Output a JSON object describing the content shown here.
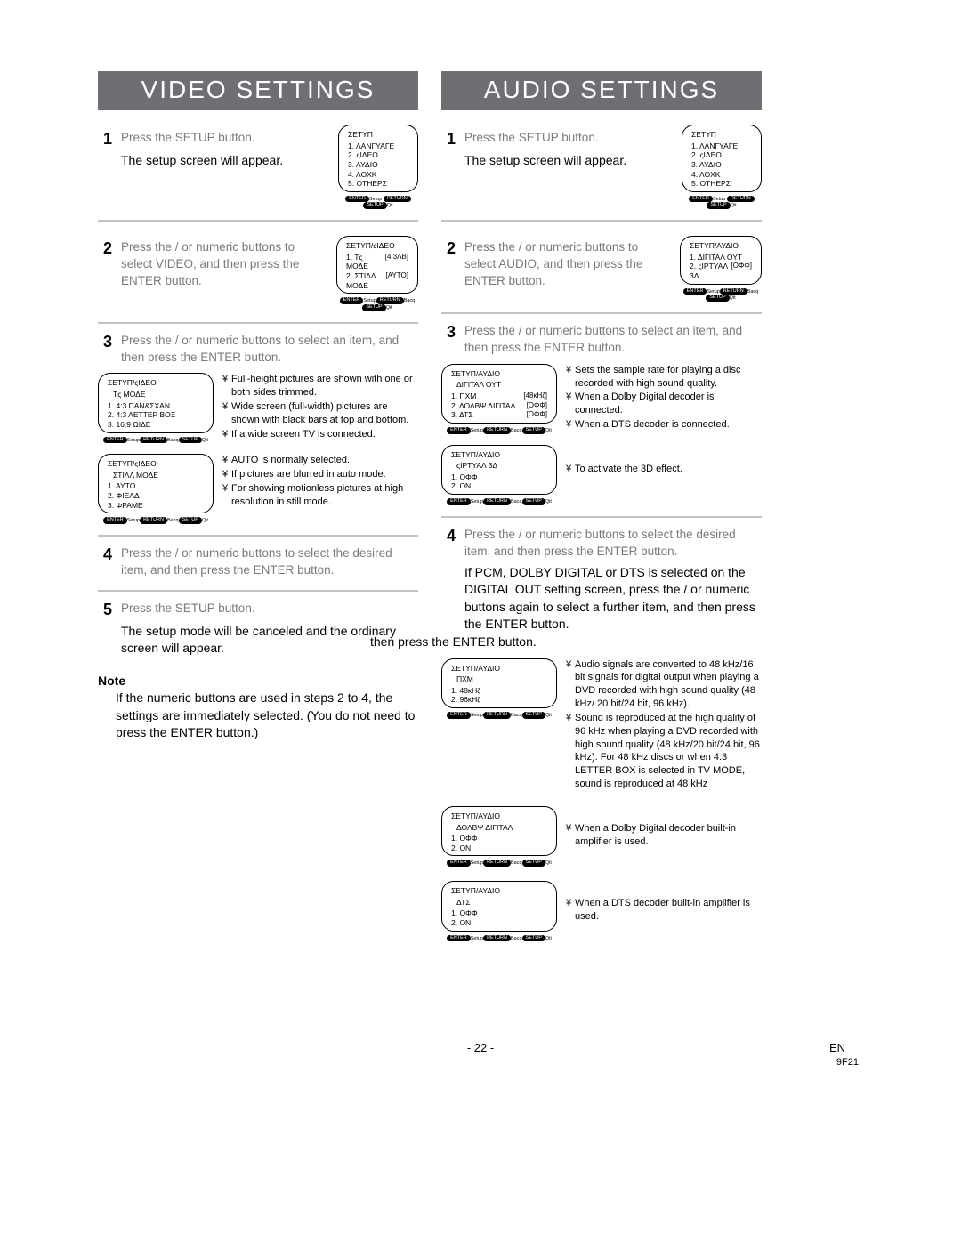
{
  "headers": {
    "video": "VIDEO SETTINGS",
    "audio": "AUDIO SETTINGS"
  },
  "video": {
    "step1": {
      "num": "1",
      "instr": "Press the SETUP button.",
      "result": "The setup screen will appear.",
      "osd": {
        "title": "ΣΕΤΥΠ",
        "items": [
          "1. ΛΑΝΓΥΑΓΕ",
          "2. ςΙΔΕΟ",
          "3. ΑΥΔΙΟ",
          "4. ΛΟΧΚ",
          "5. ΟΤΗΕΡΣ"
        ]
      }
    },
    "step2": {
      "num": "2",
      "instr": "Press the    /   or numeric buttons to select VIDEO, and then press the ENTER button.",
      "osd": {
        "title": "ΣΕΤΥΠ/ςΙΔΕΟ",
        "items": [
          {
            "lab": "1. Τς ΜΟΔΕ",
            "val": "[4:3ΛΒ]"
          },
          {
            "lab": "2. ΣΤΙΛΛ ΜΟΔΕ",
            "val": "[ΑΥΤΟ]"
          }
        ]
      }
    },
    "step3": {
      "num": "3",
      "instr": "Press the    /   or numeric buttons to select an item, and then press the ENTER button.",
      "osd1": {
        "title": "ΣΕΤΥΠ/ςΙΔΕΟ",
        "sub": "Τς ΜΟΔΕ",
        "items": [
          "1. 4:3 ΠΑΝ&ΣΧΑΝ",
          "2. 4:3 ΛΕΤΤΕΡ ΒΟΞ",
          "3. 16:9 ΩΙΔΕ"
        ]
      },
      "callouts1": [
        "Full-height pictures are shown with one or both sides trimmed.",
        "Wide screen (full-width) pictures are shown with black bars at top and bottom.",
        "If a wide screen TV is connected."
      ],
      "osd2": {
        "title": "ΣΕΤΥΠ/ςΙΔΕΟ",
        "sub": "ΣΤΙΛΛ ΜΟΔΕ",
        "items": [
          "1. ΑΥΤΟ",
          "2. ΦΙΕΛΔ",
          "3. ΦΡΑΜΕ"
        ]
      },
      "callouts2": [
        "AUTO is normally selected.",
        "If pictures are blurred in auto mode.",
        "For showing motionless pictures at high resolution in still mode."
      ]
    },
    "step4": {
      "num": "4",
      "instr": "Press the    /   or numeric buttons to select the desired item, and then press the ENTER button."
    },
    "step5": {
      "num": "5",
      "instr": "Press the SETUP button.",
      "result": "The setup mode will be canceled and the ordinary screen will appear."
    },
    "note_head": "Note",
    "note": "If the numeric buttons are used in steps 2 to 4, the settings are immediately selected. (You do not need to press the ENTER button.)"
  },
  "audio": {
    "step1": {
      "num": "1",
      "instr": "Press the SETUP button.",
      "result": "The setup screen will appear.",
      "osd": {
        "title": "ΣΕΤΥΠ",
        "items": [
          "1. ΛΑΝΓΥΑΓΕ",
          "2. ςΙΔΕΟ",
          "3. ΑΥΔΙΟ",
          "4. ΛΟΧΚ",
          "5. ΟΤΗΕΡΣ"
        ]
      }
    },
    "step2": {
      "num": "2",
      "instr": "Press the    /   or numeric buttons to select AUDIO, and then press the ENTER button.",
      "osd": {
        "title": "ΣΕΤΥΠ/ΑΥΔΙΟ",
        "items": [
          {
            "lab": "1. ΔΙΓΙΤΑΛ ΟΥΤ",
            "val": ""
          },
          {
            "lab": "2. ςΙΡΤΥΑΛ 3Δ",
            "val": "[ΟΦΦ]"
          }
        ]
      }
    },
    "step3": {
      "num": "3",
      "instr": "Press the    /   or numeric buttons to select an item, and then press the ENTER button.",
      "osd1": {
        "title": "ΣΕΤΥΠ/ΑΥΔΙΟ",
        "sub": "ΔΙΓΙΤΑΛ ΟΥΤ",
        "items": [
          {
            "lab": "1. ΠΧΜ",
            "val": "[48κΗζ]"
          },
          {
            "lab": "2. ΔΟΛΒΨ ΔΙΓΙΤΑΛ",
            "val": "[ΟΦΦ]"
          },
          {
            "lab": "3. ΔΤΣ",
            "val": "[ΟΦΦ]"
          }
        ]
      },
      "callouts1": [
        "Sets the sample rate for playing a disc recorded with high sound quality.",
        "When a Dolby Digital decoder is connected.",
        "When a DTS decoder is connected."
      ],
      "osd2": {
        "title": "ΣΕΤΥΠ/ΑΥΔΙΟ",
        "sub": "ςΙΡΤΥΑΛ 3Δ",
        "items": [
          "1. ΟΦΦ",
          "2. ΟΝ"
        ]
      },
      "callouts2": [
        "To activate the 3D effect."
      ]
    },
    "step4": {
      "num": "4",
      "instr": "Press the    /   or numeric buttons to select the desired item, and then press the ENTER button."
    },
    "conditional": "If PCM, DOLBY DIGITAL or DTS is selected on the DIGITAL OUT setting screen, press the  /  or numeric buttons again to select a further item, and then press the ENTER button.",
    "pcm_osd": {
      "title": "ΣΕΤΥΠ/ΑΥΔΙΟ",
      "sub": "ΠΧΜ",
      "items": [
        "1. 48κΗζ",
        "2. 96κΗζ"
      ]
    },
    "pcm_callouts": [
      "Audio signals are converted to 48 kHz/16 bit signals for digital output when playing a DVD recorded with high sound quality (48 kHz/ 20 bit/24 bit, 96 kHz).",
      "Sound is reproduced at the high quality of 96 kHz when playing a DVD recorded with high sound quality (48 kHz/20 bit/24 bit, 96 kHz). For 48 kHz discs or when 4:3 LETTER BOX is selected in TV MODE, sound is reproduced at 48 kHz"
    ],
    "dolby_osd": {
      "title": "ΣΕΤΥΠ/ΑΥΔΙΟ",
      "sub": "ΔΟΛΒΨ ΔΙΓΙΤΑΛ",
      "items": [
        "1. ΟΦΦ",
        "2. ΟΝ"
      ]
    },
    "dolby_callouts": [
      "When a Dolby Digital decoder built-in amplifier is used."
    ],
    "dts_osd": {
      "title": "ΣΕΤΥΠ/ΑΥΔΙΟ",
      "sub": "ΔΤΣ",
      "items": [
        "1. ΟΦΦ",
        "2. ΟΝ"
      ]
    },
    "dts_callouts": [
      "When a DTS decoder built-in amplifier is used."
    ]
  },
  "osd_btns": {
    "enter": "ENTER",
    "setup_lbl": "Setup",
    "return": "RETURN",
    "bacq": "Bacq",
    "setup": "SETUP",
    "qit": "Qit"
  },
  "footer": {
    "page": "- 22 -",
    "en": "EN",
    "code": "9F21"
  },
  "cont_text": "then press the ENTER button."
}
